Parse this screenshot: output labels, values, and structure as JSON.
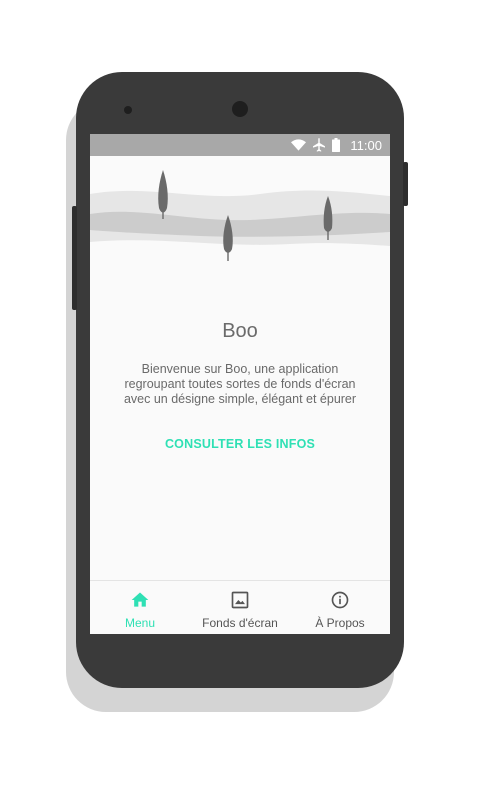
{
  "status_bar": {
    "time": "11:00",
    "icons": [
      "wifi-icon",
      "airplane-icon",
      "battery-icon"
    ]
  },
  "main": {
    "title": "Boo",
    "description": "Bienvenue sur Boo, une application regroupant toutes sortes de fonds d'écran avec un désigne simple, élégant et épurer",
    "cta_label": "CONSULTER LES INFOS"
  },
  "bottom_nav": {
    "items": [
      {
        "label": "Menu",
        "icon": "home-icon",
        "active": true
      },
      {
        "label": "Fonds d'écran",
        "icon": "image-icon",
        "active": false
      },
      {
        "label": "À Propos",
        "icon": "info-icon",
        "active": false
      }
    ]
  },
  "colors": {
    "accent": "#2fe0b4",
    "status_bar": "#a8a8a8",
    "text": "#6a6a6a",
    "phone_body": "#3a3a3a"
  }
}
